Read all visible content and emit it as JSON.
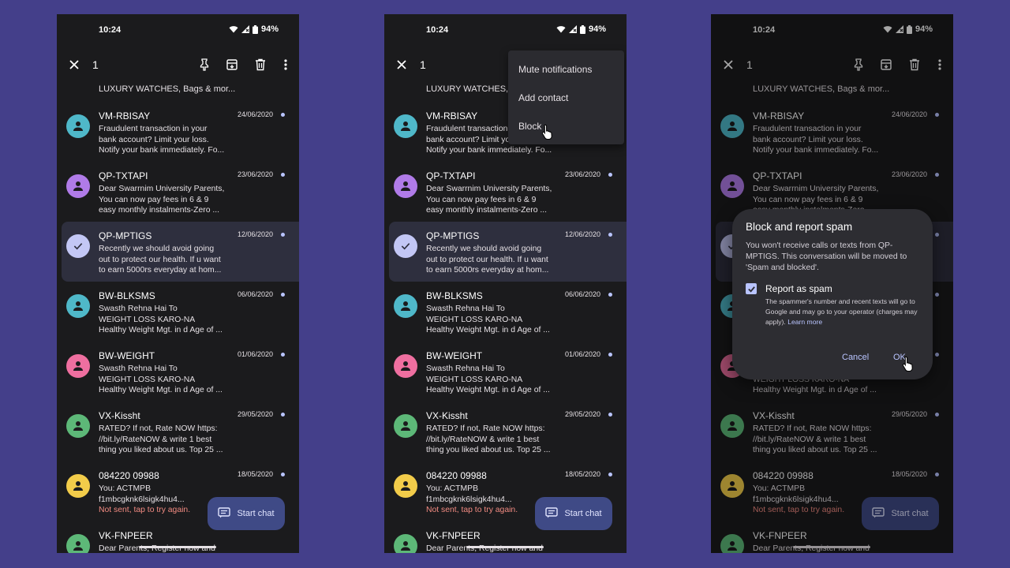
{
  "status": {
    "time": "10:24",
    "battery": "94%"
  },
  "topbar": {
    "selected_count": "1"
  },
  "peek_text": "LUXURY WATCHES, Bags & mor...",
  "conversations": [
    {
      "name": "VM-RBISAY",
      "date": "24/06/2020",
      "color": "#4fb8c9",
      "lines": [
        "Fraudulent transaction in your",
        "bank account? Limit your loss.",
        "Notify your bank immediately. Fo..."
      ]
    },
    {
      "name": "QP-TXTAPI",
      "date": "23/06/2020",
      "color": "#b07be8",
      "lines": [
        "Dear Swarrnim University Parents,",
        "You can now pay fees in 6 & 9",
        "easy monthly instalments-Zero ..."
      ]
    },
    {
      "name": "QP-MPTIGS",
      "date": "12/06/2020",
      "color": "#c3c7f5",
      "lines": [
        "Recently we should avoid going",
        "out to protect our health. If u want",
        "to earn 5000rs everyday at hom..."
      ]
    },
    {
      "name": "BW-BLKSMS",
      "date": "06/06/2020",
      "color": "#4fb8c9",
      "lines": [
        "Swasth Rehna Hai To",
        "WEIGHT LOSS KARO-NA",
        "Healthy Weight Mgt. in d Age of ..."
      ]
    },
    {
      "name": "BW-WEIGHT",
      "date": "01/06/2020",
      "color": "#ef6fa0",
      "lines": [
        "Swasth Rehna Hai To",
        "WEIGHT LOSS KARO-NA",
        "Healthy Weight Mgt. in d Age of ..."
      ]
    },
    {
      "name": "VX-Kissht",
      "date": "29/05/2020",
      "color": "#5db878",
      "lines": [
        "RATED? If not, Rate NOW https:",
        "//bit.ly/RateNOW & write 1 best",
        "thing you liked about us. Top 25 ..."
      ]
    },
    {
      "name": "084220 09988",
      "date": "18/05/2020",
      "color": "#f2cc4a",
      "lines": [
        "You: ACTMPB f1mbcgknk6lsigk4hu4...",
        "Not sent, tap to try again."
      ]
    },
    {
      "name": "VK-FNPEER",
      "date": "",
      "color": "#5db878",
      "lines": [
        "Dear Parents, Register now and sta..."
      ]
    }
  ],
  "fab": {
    "label": "Start chat"
  },
  "menu": {
    "items": [
      "Mute notifications",
      "Add contact",
      "Block"
    ]
  },
  "dialog": {
    "title": "Block and report spam",
    "body": "You won't receive calls or texts from QP-MPTIGS. This conversation will be moved to 'Spam and blocked'.",
    "checkbox_label": "Report as spam",
    "checkbox_desc": "The spammer's number and recent texts will go to Google and may go to your operator (charges may apply).",
    "learn_more": "Learn more",
    "cancel": "Cancel",
    "ok": "OK"
  },
  "colors": {
    "background": "#443f8a",
    "screen": "#1b1b1d",
    "accent": "#b9c4ff",
    "error": "#f28b82",
    "fab": "#3f4a86"
  }
}
